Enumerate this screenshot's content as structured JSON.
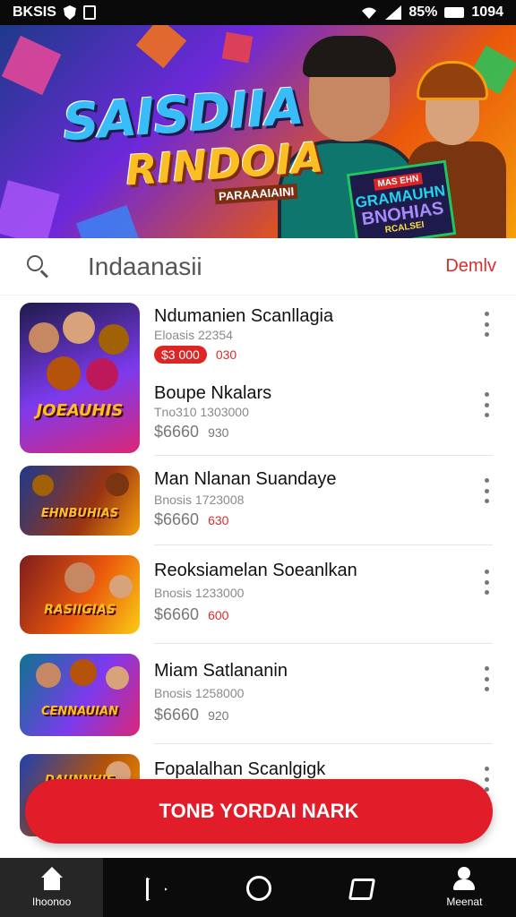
{
  "status_bar": {
    "carrier": "BKSIS",
    "battery": "85%",
    "time": "1094"
  },
  "banner": {
    "title_line1": "SAISDIIA",
    "title_line2": "RINDOIA",
    "subtitle": "PARAAAIAINI",
    "badge_tag": "MAS EHN",
    "badge_line1": "GRAMAUHN",
    "badge_line2": "BNOHIAS",
    "badge_line3": "RCALSEI"
  },
  "search": {
    "query": "Indaanasii",
    "action_label": "Demlv"
  },
  "items": [
    {
      "title": "Ndumanien Scanllagia",
      "subtitle": "Eloasis 22354",
      "price": "$3 000",
      "price_extra": "030",
      "thumb_label": "JOEAUHIS",
      "thumb_colors": [
        "#1e1b4b",
        "#7c3aed",
        "#db2777"
      ]
    },
    {
      "title": "Boupe Nkalars",
      "subtitle": "Tno310 1303000",
      "price": "$6660",
      "price_extra": "930"
    },
    {
      "title": "Man Nlanan Suandaye",
      "subtitle": "Bnosis 1723008",
      "price": "$6660",
      "price_extra": "630",
      "thumb_label": "EHNBUHIAS",
      "thumb_colors": [
        "#1e3a8a",
        "#9a3412",
        "#f59e0b"
      ]
    },
    {
      "title": "Reoksiamelan Soeanlkan",
      "subtitle": "Bnosis 1233000",
      "price": "$6660",
      "price_extra": "600",
      "thumb_label": "RASIIGIAS",
      "thumb_colors": [
        "#7f1d1d",
        "#ea580c",
        "#facc15"
      ]
    },
    {
      "title": "Miam Satlananin",
      "subtitle": "Bnosis 1258000",
      "price": "$6660",
      "price_extra": "920",
      "thumb_label": "CENNAUIAN",
      "thumb_colors": [
        "#0e7490",
        "#7c3aed",
        "#db2777"
      ]
    },
    {
      "title": "Fopalalhan Scanlgigk",
      "thumb_label": "DAUNNHIS",
      "thumb_colors": [
        "#1e40af",
        "#b45309",
        "#f59e0b"
      ]
    }
  ],
  "cta": {
    "label": "TONB YORDAI NARK"
  },
  "bottom_nav": {
    "home_label": "Ihoonoo",
    "profile_label": "Meenat"
  },
  "colors": {
    "accent": "#e11d2a",
    "nav_bg": "#0b0b0b"
  }
}
